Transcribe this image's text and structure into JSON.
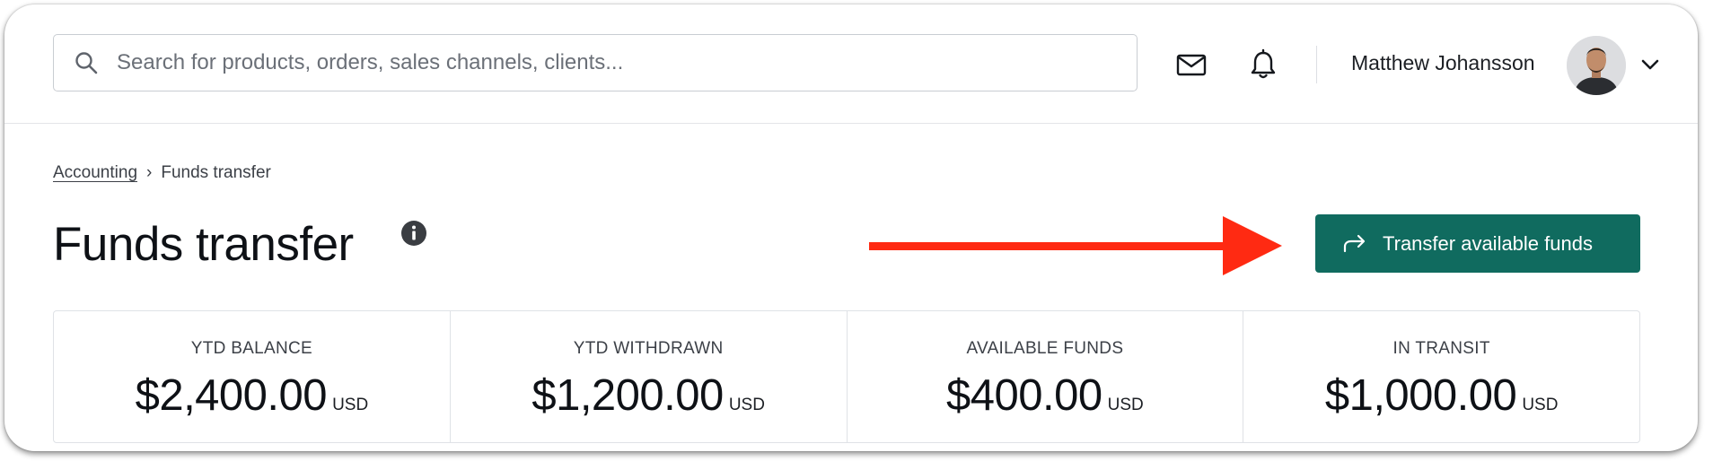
{
  "search": {
    "placeholder": "Search for products, orders, sales channels, clients..."
  },
  "header": {
    "user_name": "Matthew Johansson"
  },
  "breadcrumb": {
    "parent": "Accounting",
    "separator": "›",
    "current": "Funds transfer"
  },
  "page": {
    "title": "Funds transfer"
  },
  "actions": {
    "transfer_label": "Transfer available funds"
  },
  "stats": [
    {
      "label": "YTD BALANCE",
      "amount": "$2,400.00",
      "currency": "USD"
    },
    {
      "label": "YTD WITHDRAWN",
      "amount": "$1,200.00",
      "currency": "USD"
    },
    {
      "label": "AVAILABLE FUNDS",
      "amount": "$400.00",
      "currency": "USD"
    },
    {
      "label": "IN TRANSIT",
      "amount": "$1,000.00",
      "currency": "USD"
    }
  ],
  "colors": {
    "primary_button": "#106b5f",
    "annotation_arrow": "#ff2a12",
    "text_primary": "#0e1116",
    "border": "#dfe2e6"
  },
  "icons": {
    "search": "search-icon",
    "mail": "mail-icon",
    "notifications": "bell-icon",
    "menu": "chevron-down-icon",
    "info": "info-icon",
    "transfer": "forward-arrow-icon",
    "annotation": "red-arrow-icon"
  }
}
